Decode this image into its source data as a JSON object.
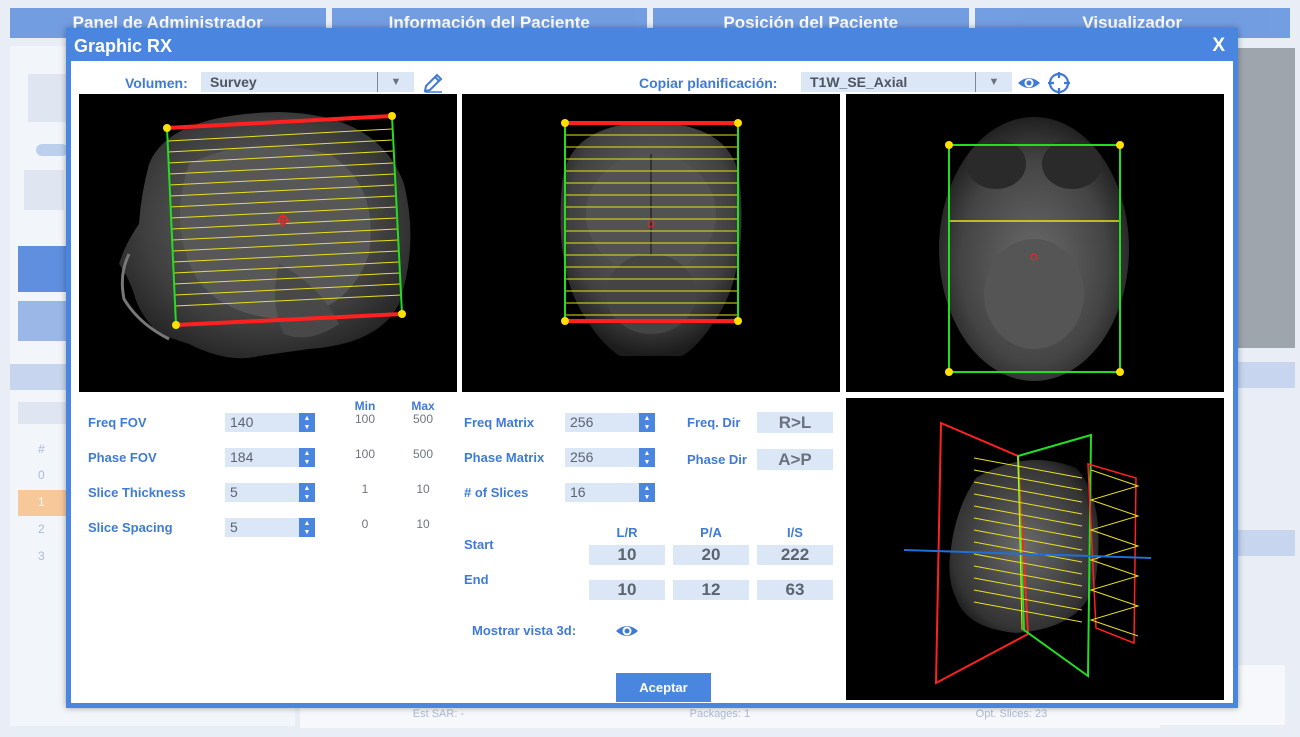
{
  "background": {
    "tabs": [
      "Panel de Administrador",
      "Información del Paciente",
      "Posición del Paciente",
      "Visualizador"
    ],
    "footer": [
      "Est SAR: -",
      "Packages: 1",
      "Opt. Slices: 23"
    ],
    "row_numbers": [
      "#",
      "0",
      "1",
      "2",
      "3"
    ]
  },
  "dialog": {
    "title": "Graphic RX",
    "close_label": "X",
    "volume_label": "Volumen:",
    "volume_value": "Survey",
    "copy_label": "Copiar planificación:",
    "copy_value": "T1W_SE_Axial",
    "icons": {
      "edit": "pencil-icon",
      "view": "eye-icon",
      "target": "crosshair-icon"
    }
  },
  "params": {
    "min_header": "Min",
    "max_header": "Max",
    "rows": [
      {
        "label": "Freq FOV",
        "value": "140",
        "min": "100",
        "max": "500"
      },
      {
        "label": "Phase FOV",
        "value": "184",
        "min": "100",
        "max": "500"
      },
      {
        "label": "Slice Thickness",
        "value": "5",
        "min": "1",
        "max": "10"
      },
      {
        "label": "Slice Spacing",
        "value": "5",
        "min": "0",
        "max": "10"
      }
    ],
    "matrix": [
      {
        "label": "Freq Matrix",
        "value": "256"
      },
      {
        "label": "Phase Matrix",
        "value": "256"
      },
      {
        "label": "# of Slices",
        "value": "16"
      }
    ],
    "dirs": [
      {
        "label": "Freq. Dir",
        "value": "R>L"
      },
      {
        "label": "Phase Dir",
        "value": "A>P"
      }
    ],
    "coord_headers": [
      "L/R",
      "P/A",
      "I/S"
    ],
    "start_label": "Start",
    "end_label": "End",
    "start": [
      "10",
      "20",
      "222"
    ],
    "end": [
      "10",
      "12",
      "63"
    ],
    "show3d_label": "Mostrar vista 3d:",
    "accept_label": "Aceptar"
  },
  "colors": {
    "accent": "#4a86e0",
    "label": "#3f7bd6",
    "field_bg": "#dbe6f6",
    "slab_edge": "#ff2020",
    "slab_box": "#22dd22",
    "slice_line": "#e8e020",
    "handle": "#ffe000"
  }
}
